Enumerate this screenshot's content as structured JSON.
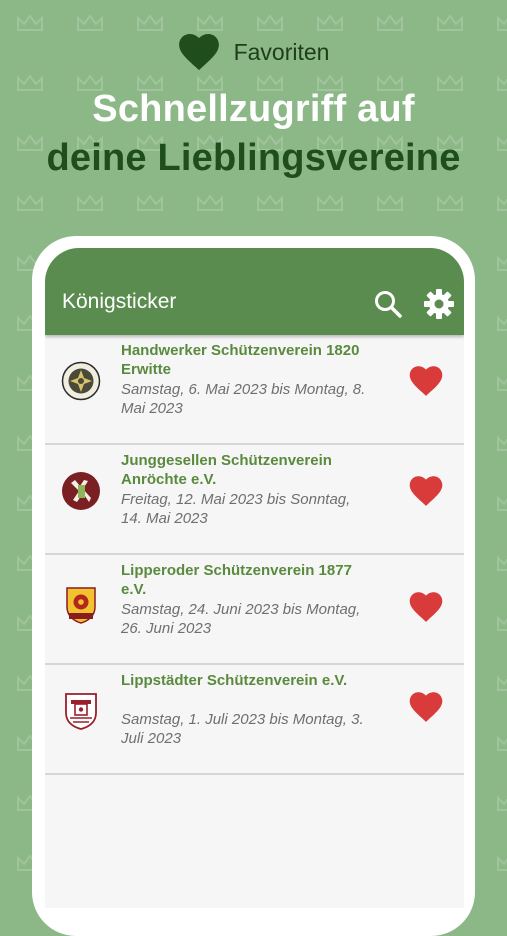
{
  "promo": {
    "badge_label": "Favoriten",
    "headline_line1": "Schnellzugriff auf",
    "headline_line2": "deine Lieblingsvereine"
  },
  "app": {
    "title": "Königsticker",
    "icons": {
      "search": "search-icon",
      "settings": "gear-icon",
      "favorite": "heart-icon"
    }
  },
  "clubs": [
    {
      "name": "Handwerker Schützenverein 1820 Erwitte",
      "dates": "Samstag, 6. Mai 2023 bis Montag, 8. Mai 2023"
    },
    {
      "name": "Junggesellen Schützenverein Anröchte e.V.",
      "dates": "Freitag, 12. Mai 2023 bis Sonntag, 14. Mai 2023"
    },
    {
      "name": "Lipperoder Schützenverein 1877 e.V.",
      "dates": "Samstag, 24. Juni 2023 bis Montag, 26. Juni 2023"
    },
    {
      "name": "Lippstädter Schützenverein e.V.",
      "dates": "Samstag, 1. Juli 2023 bis Montag, 3. Juli 2023"
    }
  ],
  "colors": {
    "background": "#8bb886",
    "app_bar": "#5b8c4f",
    "club_name": "#5a8a3e",
    "heart": "#d93a3a",
    "headline_dark": "#1f4d1c"
  }
}
